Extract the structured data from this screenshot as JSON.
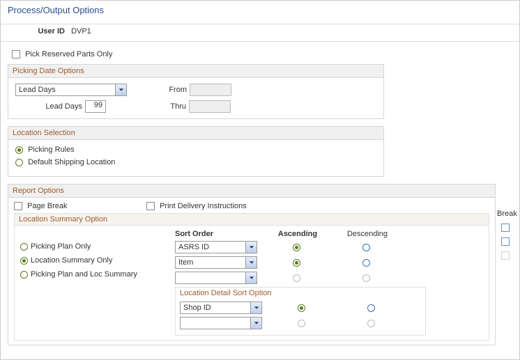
{
  "header": {
    "title": "Process/Output Options"
  },
  "user": {
    "label": "User ID",
    "value": "DVP1"
  },
  "pick_reserved": {
    "label": "Pick Reserved Parts Only",
    "checked": false
  },
  "picking_date": {
    "title": "Picking Date Options",
    "mode_options": [
      "Lead Days"
    ],
    "mode_value": "Lead Days",
    "lead_days_label": "Lead Days",
    "lead_days_value": "99",
    "from_label": "From",
    "thru_label": "Thru",
    "from_value": "",
    "thru_value": ""
  },
  "location_selection": {
    "title": "Location Selection",
    "options": [
      {
        "label": "Picking Rules",
        "selected": true
      },
      {
        "label": "Default Shipping Location",
        "selected": false
      }
    ]
  },
  "report": {
    "title": "Report Options",
    "page_break": {
      "label": "Page Break",
      "checked": false
    },
    "print_delivery": {
      "label": "Print Delivery Instructions",
      "checked": false
    },
    "loc_summary": {
      "title": "Location Summary Option",
      "options": [
        {
          "label": "Picking Plan Only",
          "selected": false
        },
        {
          "label": "Location Summary Only",
          "selected": true
        },
        {
          "label": "Picking Plan and Loc Summary",
          "selected": false
        }
      ],
      "sort_header": "Sort Order",
      "asc_header": "Ascending",
      "desc_header": "Descending",
      "break_header": "Break",
      "sort_rows": [
        {
          "value": "ASRS ID",
          "asc": true,
          "desc": false,
          "enabled": true,
          "break": false
        },
        {
          "value": "Item",
          "asc": true,
          "desc": false,
          "enabled": true,
          "break": false
        },
        {
          "value": "",
          "asc": false,
          "desc": false,
          "enabled": false,
          "break": false
        }
      ],
      "detail": {
        "title": "Location Detail Sort Option",
        "rows": [
          {
            "value": "Shop ID",
            "asc": true,
            "desc": false,
            "enabled": true
          },
          {
            "value": "",
            "asc": false,
            "desc": false,
            "enabled": false
          }
        ]
      }
    }
  }
}
